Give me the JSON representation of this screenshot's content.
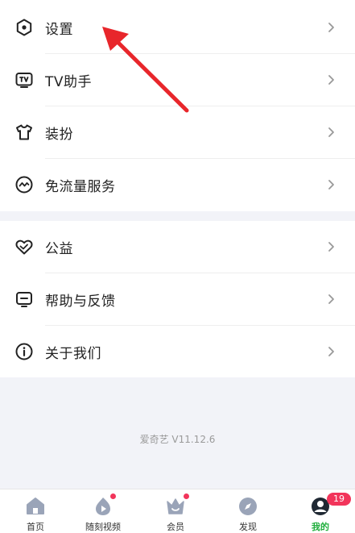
{
  "menu": {
    "group1": [
      {
        "label": "设置",
        "icon": "hexagon-settings-icon"
      },
      {
        "label": "TV助手",
        "icon": "tv-icon"
      },
      {
        "label": "装扮",
        "icon": "tshirt-icon"
      },
      {
        "label": "免流量服务",
        "icon": "wave-circle-icon"
      }
    ],
    "group2": [
      {
        "label": "公益",
        "icon": "heart-icon"
      },
      {
        "label": "帮助与反馈",
        "icon": "chat-box-icon"
      },
      {
        "label": "关于我们",
        "icon": "info-circle-icon"
      }
    ]
  },
  "version": "爱奇艺 V11.12.6",
  "tabbar": {
    "tabs": [
      {
        "label": "首页",
        "icon": "home-icon"
      },
      {
        "label": "随刻视频",
        "icon": "flame-play-icon"
      },
      {
        "label": "会员",
        "icon": "crown-icon"
      },
      {
        "label": "发现",
        "icon": "compass-icon"
      },
      {
        "label": "我的",
        "icon": "avatar-icon"
      }
    ],
    "badge": "19"
  },
  "colors": {
    "accent": "#1fae3c",
    "badge": "#f2355b",
    "annotation_arrow": "#e8262b",
    "icon_stroke": "#222222",
    "tab_icon": "#9aa4b8"
  }
}
